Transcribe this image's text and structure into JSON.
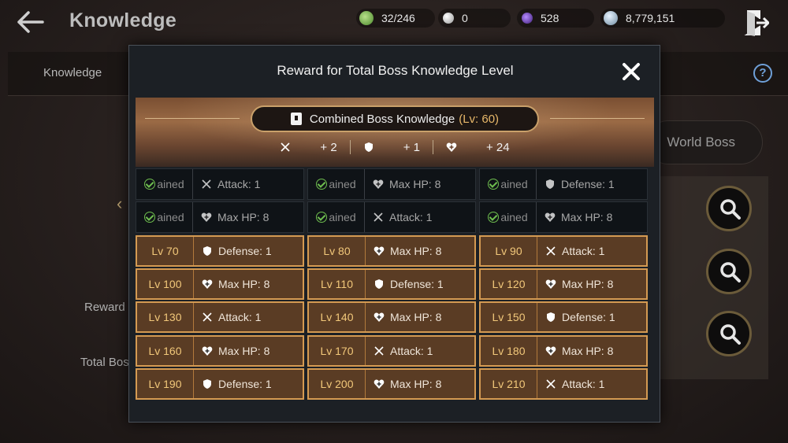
{
  "header": {
    "title": "Knowledge",
    "resources": [
      {
        "icon": "green-gem-icon",
        "value": "32/246"
      },
      {
        "icon": "pearl-icon",
        "value": "0"
      },
      {
        "icon": "purple-orb-icon",
        "value": "528"
      },
      {
        "icon": "silver-coin-icon",
        "value": "8,779,151"
      }
    ]
  },
  "background": {
    "tab_label": "Knowledge",
    "world_boss_label": "World Boss",
    "reward_label": "Reward",
    "total_boss_label": "Total Bos"
  },
  "modal": {
    "title": "Reward for Total Boss Knowledge Level",
    "combined_label": "Combined Boss Knowledge",
    "combined_level": "(Lv: 60)",
    "stats": [
      {
        "icon": "crossed-swords-icon",
        "value": "+ 2"
      },
      {
        "icon": "shield-icon",
        "value": "+ 1"
      },
      {
        "icon": "heart-plus-icon",
        "value": "+ 24"
      }
    ],
    "rewards": [
      {
        "state": "obtained",
        "level": "ained",
        "icon": "crossed-swords-icon",
        "reward": "Attack: 1"
      },
      {
        "state": "obtained",
        "level": "ained",
        "icon": "heart-plus-icon",
        "reward": "Max HP: 8"
      },
      {
        "state": "obtained",
        "level": "ained",
        "icon": "shield-icon",
        "reward": "Defense: 1"
      },
      {
        "state": "obtained",
        "level": "ained",
        "icon": "heart-plus-icon",
        "reward": "Max HP: 8"
      },
      {
        "state": "obtained",
        "level": "ained",
        "icon": "crossed-swords-icon",
        "reward": "Attack: 1"
      },
      {
        "state": "obtained",
        "level": "ained",
        "icon": "heart-plus-icon",
        "reward": "Max HP: 8"
      },
      {
        "state": "locked",
        "level": "Lv 70",
        "icon": "shield-icon",
        "reward": "Defense: 1"
      },
      {
        "state": "locked",
        "level": "Lv 80",
        "icon": "heart-plus-icon",
        "reward": "Max HP: 8"
      },
      {
        "state": "locked",
        "level": "Lv 90",
        "icon": "crossed-swords-icon",
        "reward": "Attack: 1"
      },
      {
        "state": "locked",
        "level": "Lv 100",
        "icon": "heart-plus-icon",
        "reward": "Max HP: 8"
      },
      {
        "state": "locked",
        "level": "Lv 110",
        "icon": "shield-icon",
        "reward": "Defense: 1"
      },
      {
        "state": "locked",
        "level": "Lv 120",
        "icon": "heart-plus-icon",
        "reward": "Max HP: 8"
      },
      {
        "state": "locked",
        "level": "Lv 130",
        "icon": "crossed-swords-icon",
        "reward": "Attack: 1"
      },
      {
        "state": "locked",
        "level": "Lv 140",
        "icon": "heart-plus-icon",
        "reward": "Max HP: 8"
      },
      {
        "state": "locked",
        "level": "Lv 150",
        "icon": "shield-icon",
        "reward": "Defense: 1"
      },
      {
        "state": "locked",
        "level": "Lv 160",
        "icon": "heart-plus-icon",
        "reward": "Max HP: 8"
      },
      {
        "state": "locked",
        "level": "Lv 170",
        "icon": "crossed-swords-icon",
        "reward": "Attack: 1"
      },
      {
        "state": "locked",
        "level": "Lv 180",
        "icon": "heart-plus-icon",
        "reward": "Max HP: 8"
      },
      {
        "state": "locked",
        "level": "Lv 190",
        "icon": "shield-icon",
        "reward": "Defense: 1"
      },
      {
        "state": "locked",
        "level": "Lv 200",
        "icon": "heart-plus-icon",
        "reward": "Max HP: 8"
      },
      {
        "state": "locked",
        "level": "Lv 210",
        "icon": "crossed-swords-icon",
        "reward": "Attack: 1"
      }
    ]
  },
  "colors": {
    "obtained_check": "#6fbf4f",
    "locked_border": "#d49a52",
    "locked_level_text": "#f2c87a",
    "level_highlight": "#e8b86a"
  }
}
